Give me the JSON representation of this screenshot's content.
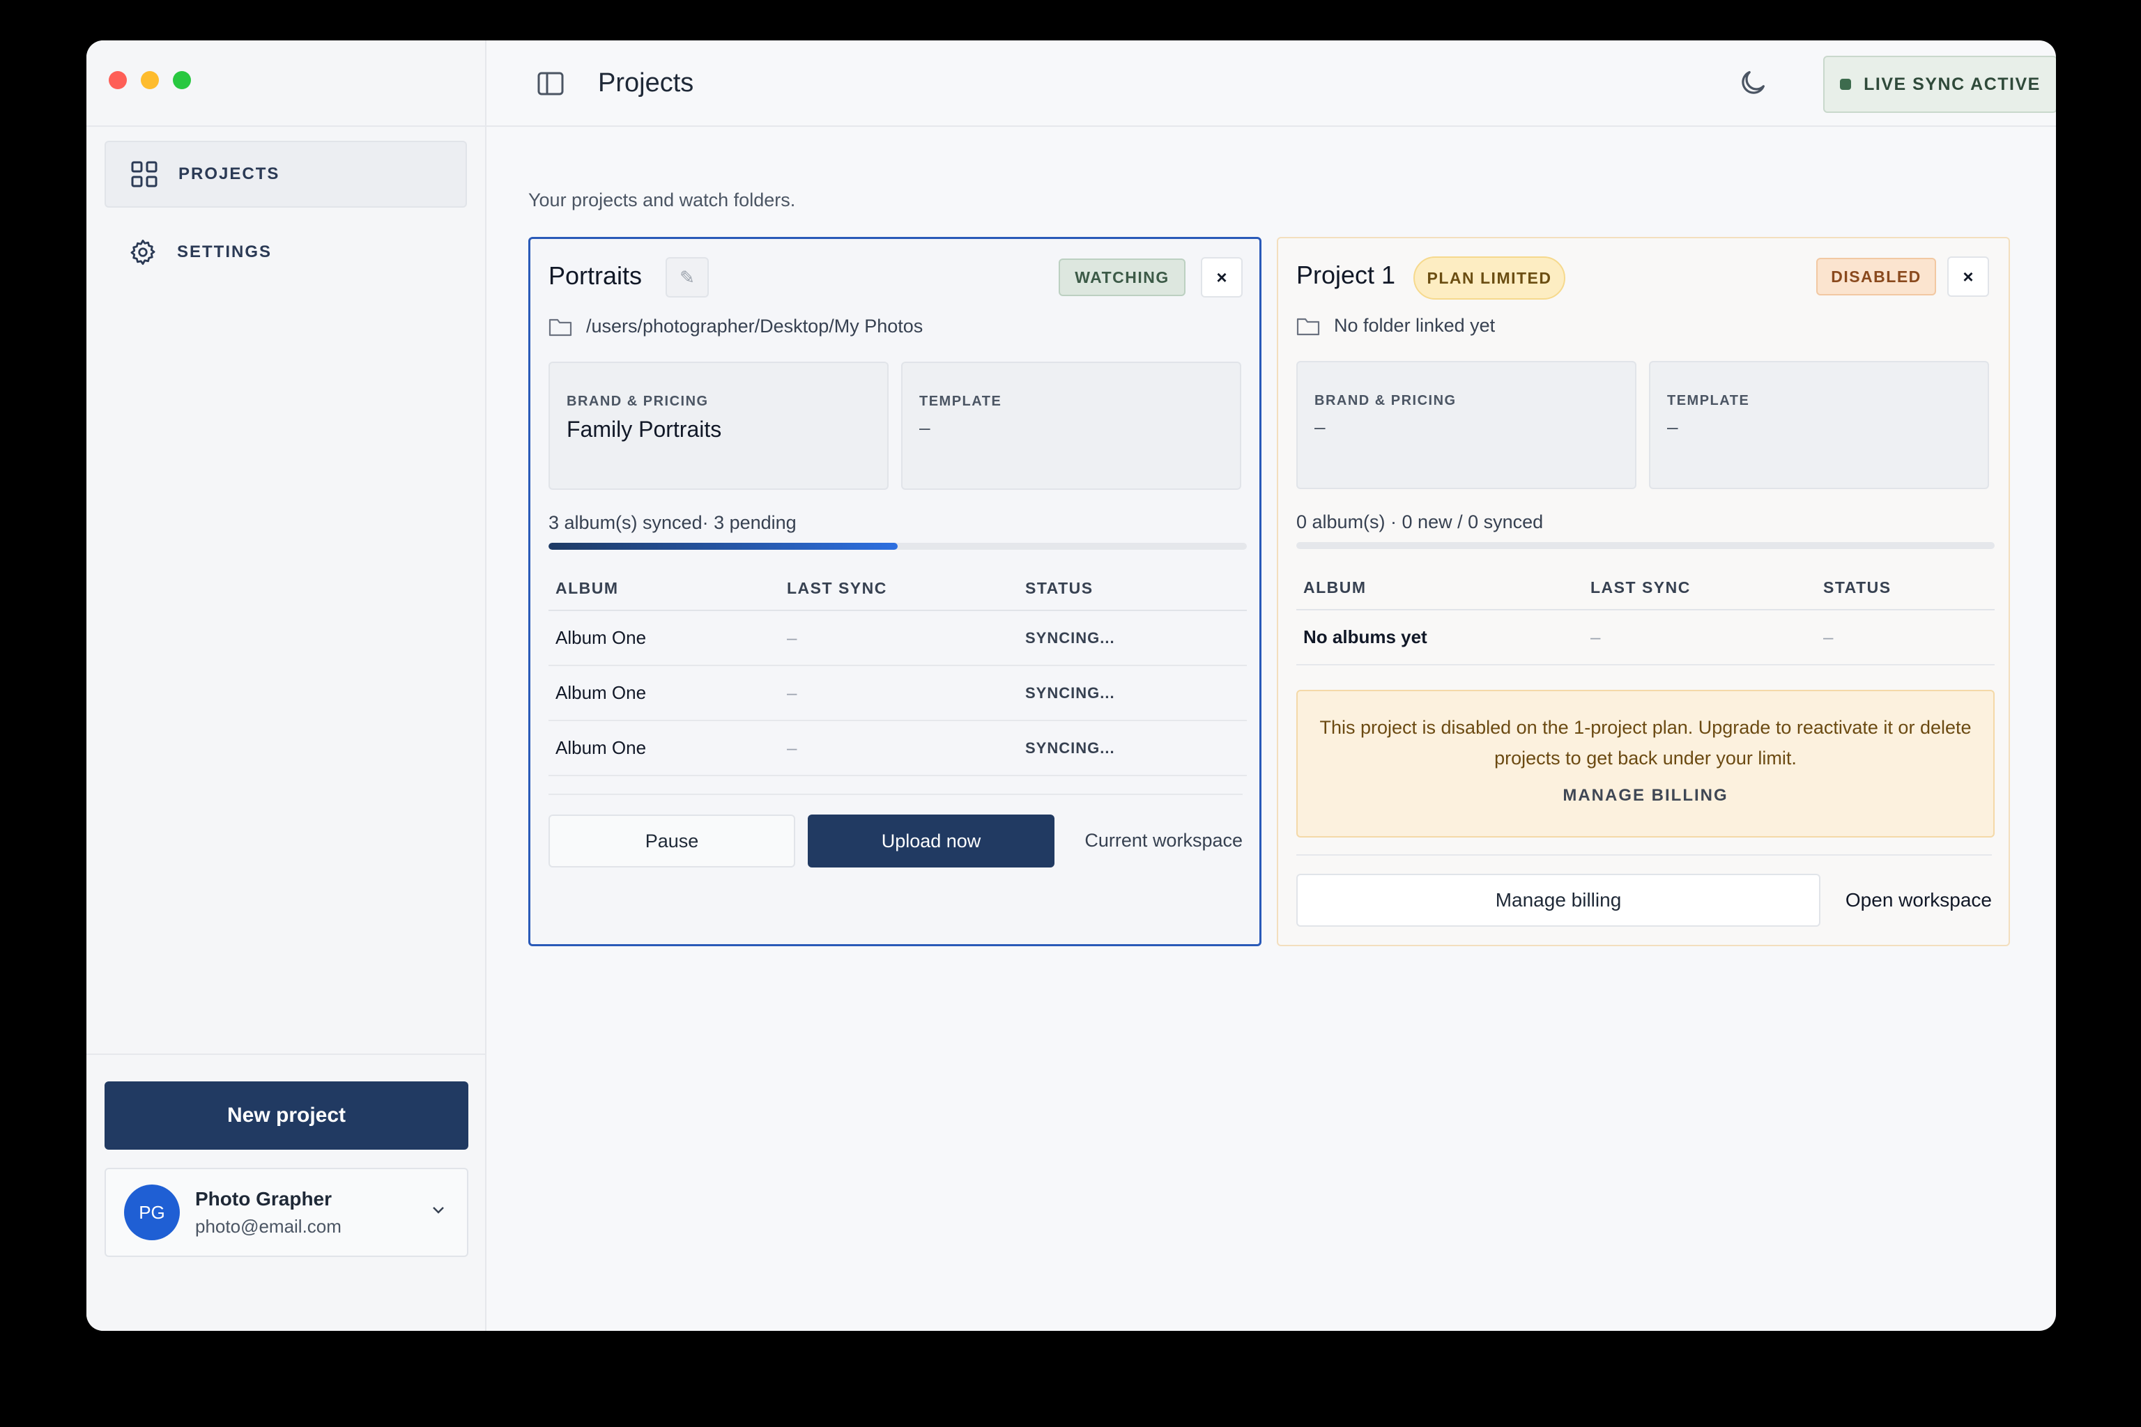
{
  "sidebar": {
    "items": [
      {
        "label": "PROJECTS",
        "icon": "grid-icon",
        "active": true
      },
      {
        "label": "SETTINGS",
        "icon": "gear-icon",
        "active": false
      }
    ],
    "new_project_label": "New project",
    "user": {
      "initials": "PG",
      "name": "Photo Grapher",
      "email": "photo@email.com"
    }
  },
  "header": {
    "title": "Projects",
    "live_sync_label": "LIVE SYNC ACTIVE"
  },
  "main": {
    "subtitle": "Your projects and watch folders.",
    "projects": [
      {
        "name": "Portraits",
        "edit_icon": "pencil-icon",
        "status_badge": "WATCHING",
        "close_label": "×",
        "folder_path": "/users/photographer/Desktop/My Photos",
        "brand_label": "BRAND & PRICING",
        "brand_value": "Family Portraits",
        "template_label": "TEMPLATE",
        "template_value": "–",
        "sync_summary": "3 album(s) synced· 3 pending",
        "progress": 0.5,
        "table": {
          "headers": [
            "ALBUM",
            "LAST SYNC",
            "STATUS"
          ],
          "rows": [
            {
              "album": "Album One",
              "last_sync": "–",
              "status": "SYNCING..."
            },
            {
              "album": "Album One",
              "last_sync": "–",
              "status": "SYNCING..."
            },
            {
              "album": "Album One",
              "last_sync": "–",
              "status": "SYNCING..."
            }
          ]
        },
        "pause_label": "Pause",
        "upload_label": "Upload now",
        "workspace_label": "Current workspace"
      },
      {
        "name": "Project 1",
        "plan_badge": "PLAN LIMITED",
        "status_badge": "DISABLED",
        "close_label": "×",
        "folder_path": "No folder linked yet",
        "brand_label": "BRAND & PRICING",
        "brand_value": "–",
        "template_label": "TEMPLATE",
        "template_value": "–",
        "sync_summary": "0 album(s) · 0 new / 0 synced",
        "progress": 0,
        "table": {
          "headers": [
            "ALBUM",
            "LAST SYNC",
            "STATUS"
          ],
          "rows": [
            {
              "album": "No albums yet",
              "last_sync": "–",
              "status": "–"
            }
          ]
        },
        "warning_text": "This project is disabled on the 1-project plan. Upgrade to reactivate it or delete projects to get back under your limit.",
        "warning_link": "MANAGE BILLING",
        "billing_label": "Manage billing",
        "open_label": "Open workspace"
      }
    ]
  },
  "colors": {
    "accent": "#213a62",
    "active_border": "#2a5ab8",
    "warning_bg": "#fcf1de",
    "watching_badge": "#dde7df",
    "disabled_badge": "#fbe4cf"
  }
}
